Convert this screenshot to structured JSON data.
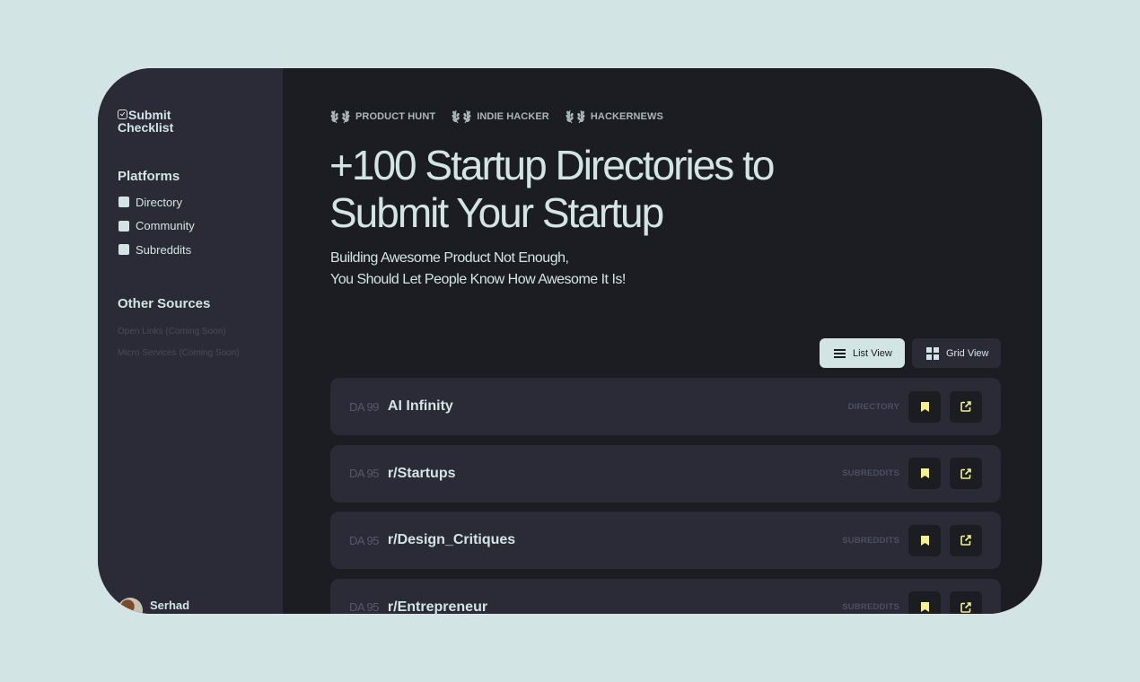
{
  "app": {
    "logo_line1": "Submit",
    "logo_line2": "Checklist"
  },
  "sidebar": {
    "platforms_title": "Platforms",
    "platforms": [
      {
        "label": "Directory",
        "checked": false
      },
      {
        "label": "Community",
        "checked": false
      },
      {
        "label": "Subreddits",
        "checked": false
      }
    ],
    "other_title": "Other Sources",
    "other_sources": [
      {
        "label": "Open Links (Coming Soon)"
      },
      {
        "label": "Micro Services (Coming Soon)"
      }
    ],
    "user": {
      "name": "Serhad"
    }
  },
  "header": {
    "badges": [
      {
        "label": "PRODUCT HUNT",
        "icon": "laurel-icon"
      },
      {
        "label": "INDIE HACKER",
        "icon": "laurel-icon"
      },
      {
        "label": "HACKERNEWS",
        "icon": "laurel-icon"
      }
    ],
    "title_line1": "+100 Startup Directories to",
    "title_line2": "Submit Your Startup",
    "subtitle_line1": "Building Awesome Product Not Enough,",
    "subtitle_line2": "You Should Let People Know How Awesome It Is!"
  },
  "view_toggle": {
    "list_label": "List View",
    "grid_label": "Grid View",
    "active": "list"
  },
  "colors": {
    "background": "#d2e5e4",
    "sidebar": "#2b2b37",
    "main": "#1c1d22",
    "accent_yellow": "#f3f28f",
    "text_primary": "#d2e5e4"
  },
  "items": [
    {
      "da": "DA 99",
      "name": "AI Infinity",
      "category": "DIRECTORY"
    },
    {
      "da": "DA 95",
      "name": "r/Startups",
      "category": "SUBREDDITS"
    },
    {
      "da": "DA 95",
      "name": "r/Design_Critiques",
      "category": "SUBREDDITS"
    },
    {
      "da": "DA 95",
      "name": "r/Entrepreneur",
      "category": "SUBREDDITS"
    }
  ]
}
